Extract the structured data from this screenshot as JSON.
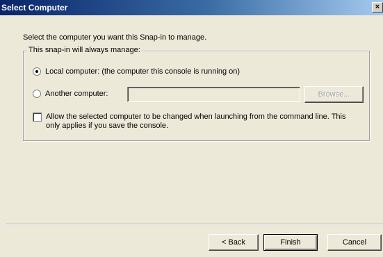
{
  "window": {
    "title": "Select Computer",
    "close_label": "×"
  },
  "intro": "Select the computer you want this Snap-in to manage.",
  "group": {
    "legend": "This snap-in will always manage:",
    "local_option": "Local computer:  (the computer this console is running on)",
    "another_option": "Another computer:",
    "another_value": "",
    "browse_label": "Browse...",
    "allow_change": "Allow the selected computer to be changed when launching from the command line.  This",
    "allow_change_2": "only applies if you save the console."
  },
  "selected_option": "local",
  "allow_change_checked": false,
  "buttons": {
    "back": "< Back",
    "finish": "Finish",
    "cancel": "Cancel"
  }
}
